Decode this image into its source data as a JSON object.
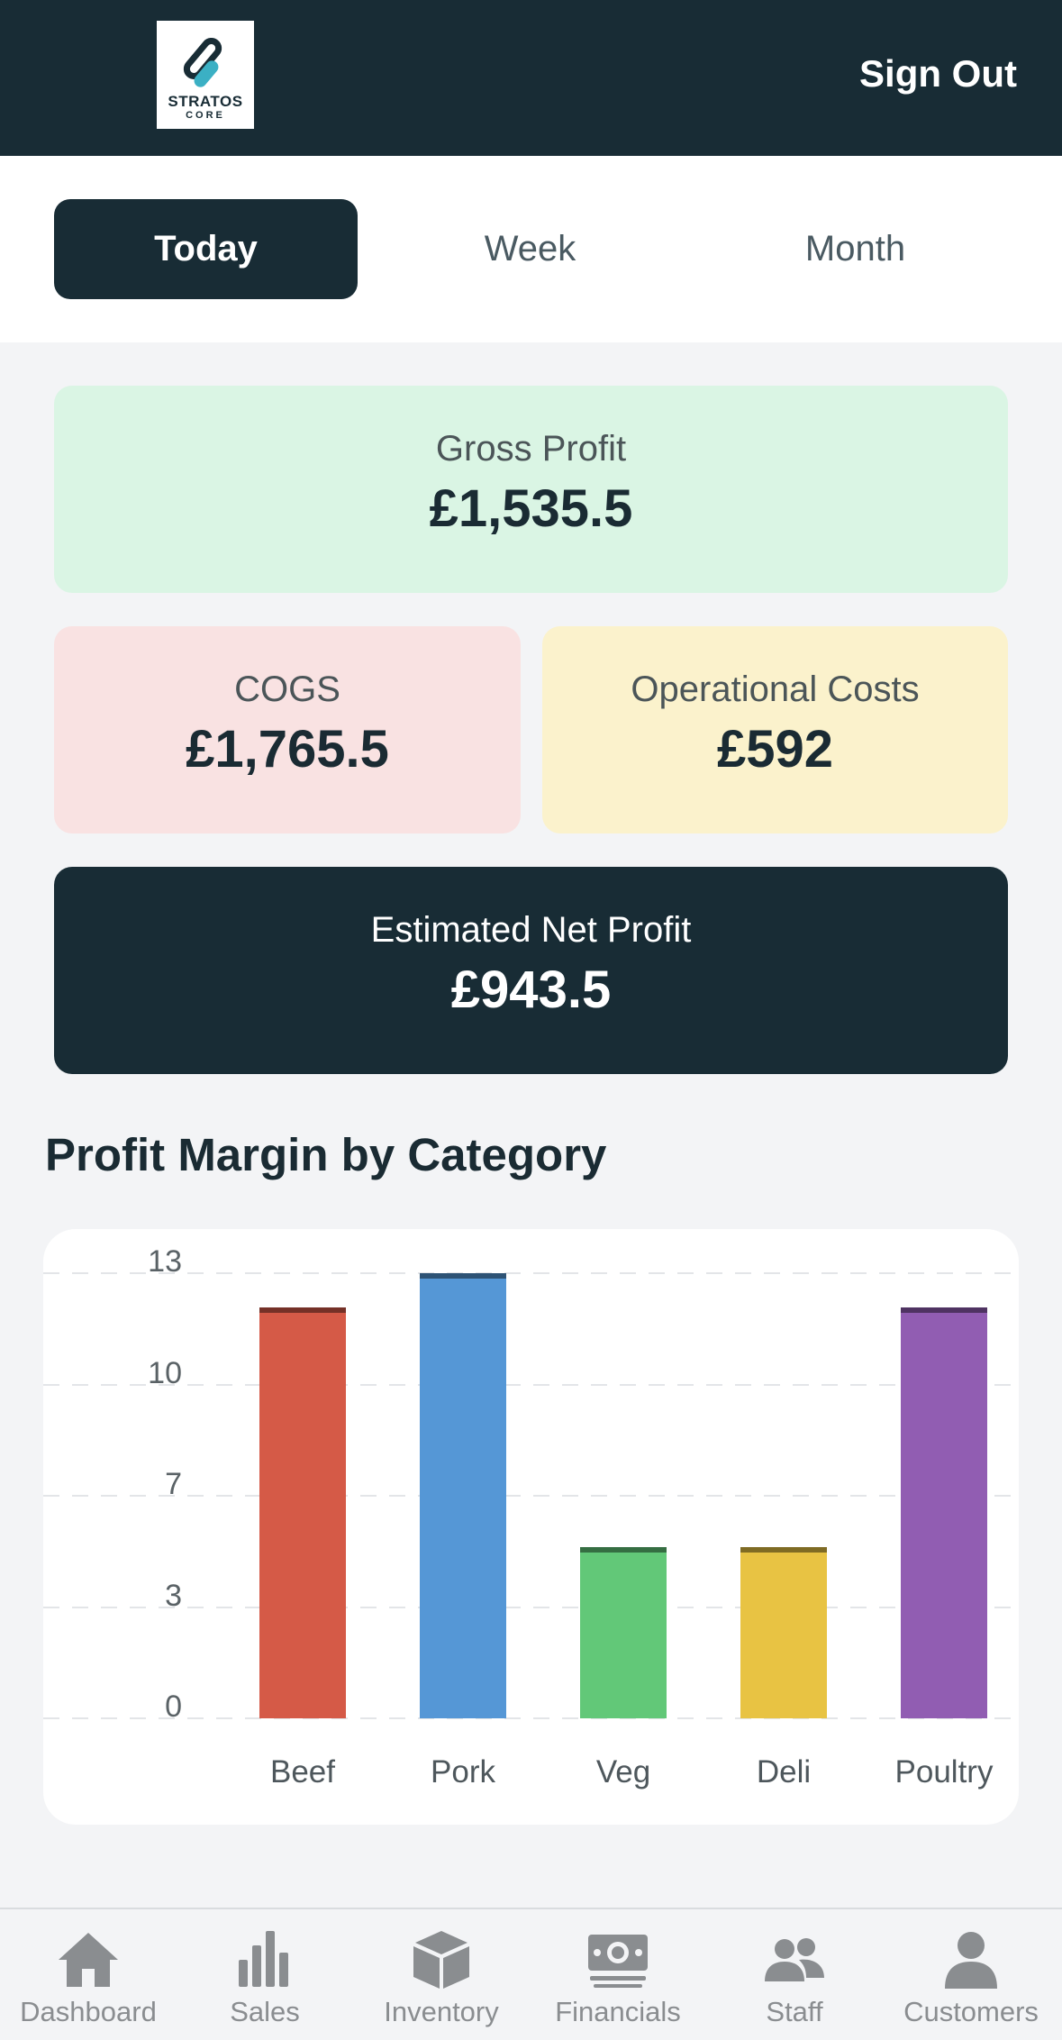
{
  "header": {
    "logo_line1": "STRATOS",
    "logo_line2": "CORE",
    "signout_label": "Sign Out"
  },
  "tabs": [
    {
      "label": "Today",
      "active": true
    },
    {
      "label": "Week",
      "active": false
    },
    {
      "label": "Month",
      "active": false
    }
  ],
  "cards": {
    "gross_profit": {
      "label": "Gross Profit",
      "value": "£1,535.5",
      "color": "#daf5e4"
    },
    "cogs": {
      "label": "COGS",
      "value": "£1,765.5",
      "color": "#f9e2e2"
    },
    "operational_costs": {
      "label": "Operational Costs",
      "value": "£592",
      "color": "#fbf2cc"
    },
    "net_profit": {
      "label": "Estimated Net Profit",
      "value": "£943.5",
      "color": "#182c35"
    }
  },
  "section_title": "Profit Margin by Category",
  "chart_data": {
    "type": "bar",
    "categories": [
      "Beef",
      "Pork",
      "Veg",
      "Deli",
      "Poultry"
    ],
    "values": [
      12,
      13,
      5,
      5,
      12
    ],
    "colors": [
      "#d55a47",
      "#5597d6",
      "#62c878",
      "#e8c343",
      "#915db2"
    ],
    "yticks": [
      "0",
      "3",
      "7",
      "10",
      "13"
    ],
    "ylim": [
      0,
      13
    ],
    "grid": true
  },
  "nav": [
    {
      "label": "Dashboard",
      "icon": "home-icon"
    },
    {
      "label": "Sales",
      "icon": "bar-chart-icon"
    },
    {
      "label": "Inventory",
      "icon": "box-icon"
    },
    {
      "label": "Financials",
      "icon": "money-icon"
    },
    {
      "label": "Staff",
      "icon": "users-icon"
    },
    {
      "label": "Customers",
      "icon": "user-icon"
    }
  ]
}
